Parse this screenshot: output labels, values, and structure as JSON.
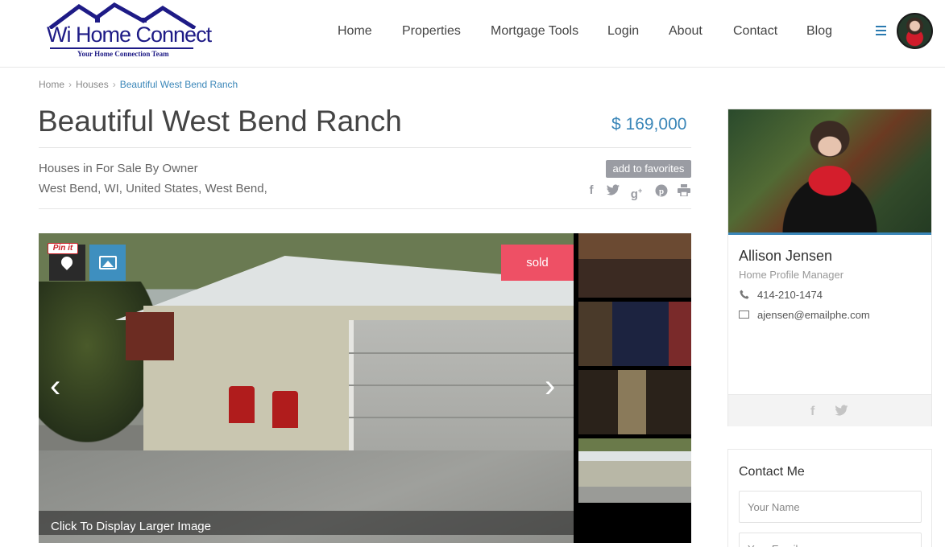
{
  "header": {
    "logo_text": "Wi Home Connect",
    "logo_tagline": "Your Home Connection Team",
    "nav": [
      "Home",
      "Properties",
      "Mortgage Tools",
      "Login",
      "About",
      "Contact",
      "Blog"
    ]
  },
  "breadcrumb": [
    "Home",
    "Houses",
    "Beautiful West Bend Ranch"
  ],
  "listing": {
    "title": "Beautiful West Bend Ranch",
    "price": "$ 169,000",
    "category": "Houses in For Sale By Owner",
    "location": "West Bend, WI, United States, West Bend,",
    "favorites_label": "add to favorites",
    "share_icons": [
      "facebook-icon",
      "twitter-icon",
      "google-plus-icon",
      "pinterest-icon",
      "print-icon"
    ]
  },
  "gallery": {
    "status_badge": "sold",
    "pin_label": "Pin it",
    "caption": "Click To Display Larger Image",
    "thumbnails": [
      "bedroom-crib",
      "bedroom-blue",
      "hallway",
      "house-exterior"
    ]
  },
  "agent": {
    "name": "Allison Jensen",
    "role": "Home Profile Manager",
    "phone": "414-210-1474",
    "email": "ajensen@emailphe.com"
  },
  "contact": {
    "title": "Contact Me",
    "name_placeholder": "Your Name",
    "email_placeholder": "Your Email"
  },
  "colors": {
    "accent": "#3a86b8",
    "sold": "#ee5065",
    "logo": "#1e1b86"
  }
}
